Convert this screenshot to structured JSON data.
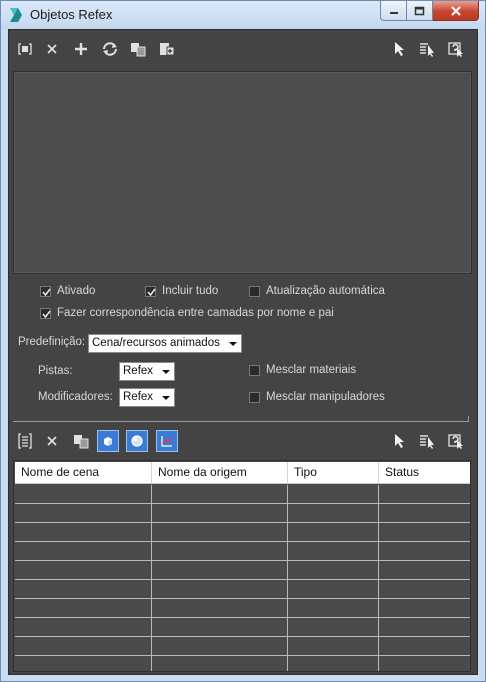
{
  "window": {
    "title": "Objetos Refex",
    "icon": "3dsmax-app-icon"
  },
  "top_toolbar": {
    "icons": [
      "add-object-icon",
      "remove-icon",
      "plus-icon",
      "refresh-icon",
      "copy-paste-icon",
      "merge-icon",
      "select-icon",
      "select-list-icon",
      "help-icon"
    ]
  },
  "options": {
    "enabled_label": "Ativado",
    "enabled_checked": true,
    "include_all_label": "Incluir tudo",
    "include_all_checked": true,
    "auto_update_label": "Atualização automática",
    "auto_update_checked": false,
    "match_layers_label": "Fazer correspondência entre camadas por nome e pai",
    "match_layers_checked": true,
    "preset_label": "Predefinição:",
    "preset_value": "Cena/recursos animados",
    "tracks_label": "Pistas:",
    "tracks_value": "Refex",
    "modifiers_label": "Modificadores:",
    "modifiers_value": "Refex",
    "merge_materials_label": "Mesclar materiais",
    "merge_materials_checked": false,
    "merge_manipulators_label": "Mesclar manipuladores",
    "merge_manipulators_checked": false
  },
  "bottom_toolbar": {
    "icons": [
      "object-list-icon",
      "remove-icon",
      "copy-paste-icon",
      "show-objects-icon",
      "show-materials-icon",
      "show-controllers-icon",
      "select-icon",
      "select-list-icon",
      "help-icon"
    ]
  },
  "table": {
    "columns": [
      "Nome de cena",
      "Nome da origem",
      "Tipo",
      "Status"
    ],
    "rows": [
      [
        "",
        "",
        "",
        ""
      ],
      [
        "",
        "",
        "",
        ""
      ],
      [
        "",
        "",
        "",
        ""
      ],
      [
        "",
        "",
        "",
        ""
      ],
      [
        "",
        "",
        "",
        ""
      ],
      [
        "",
        "",
        "",
        ""
      ],
      [
        "",
        "",
        "",
        ""
      ],
      [
        "",
        "",
        "",
        ""
      ],
      [
        "",
        "",
        "",
        ""
      ],
      [
        "",
        "",
        "",
        ""
      ]
    ]
  },
  "colors": {
    "panel_bg": "#444444",
    "accent_active": "#3b7bd4",
    "text": "#d8d8d8"
  }
}
